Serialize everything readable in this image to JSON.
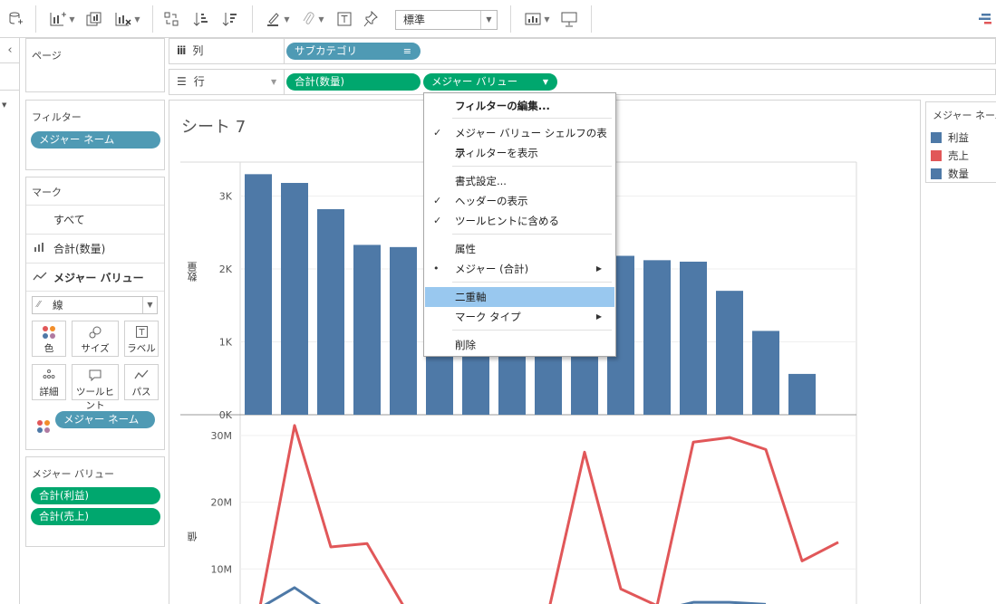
{
  "toolbar": {
    "style_select": "標準",
    "icons": [
      "new-datasource-icon",
      "new-sheet-icon",
      "duplicate-sheet-icon",
      "clear-sheet-icon",
      "swap-icon",
      "sort-asc-icon",
      "sort-desc-icon",
      "highlight-icon",
      "group-icon",
      "label-icon",
      "pin-icon",
      "show-me-icon",
      "presentation-icon"
    ]
  },
  "shelves": {
    "pages_label": "ページ",
    "columns_label": "列",
    "columns_pill": "サブカテゴリ",
    "rows_label": "行",
    "rows_pill1": "合計(数量)",
    "rows_pill2": "メジャー バリュー"
  },
  "filters": {
    "title": "フィルター",
    "pill": "メジャー ネーム"
  },
  "marks": {
    "title": "マーク",
    "all": "すべて",
    "row1": "合計(数量)",
    "row2": "メジャー バリュー",
    "mark_type": "線",
    "buttons": [
      "色",
      "サイズ",
      "ラベル",
      "詳細",
      "ツールヒント",
      "パス"
    ],
    "color_pill": "メジャー ネーム"
  },
  "measure_values": {
    "title": "メジャー バリュー",
    "items": [
      "合計(利益)",
      "合計(売上)"
    ]
  },
  "sheet_title": "シート 7",
  "legend": {
    "title": "メジャー ネーム",
    "items": [
      {
        "label": "利益",
        "color": "#4e79a7"
      },
      {
        "label": "売上",
        "color": "#e15759"
      },
      {
        "label": "数量",
        "color": "#4e79a7"
      }
    ]
  },
  "context_menu": {
    "items": [
      {
        "label": "フィルターの編集...",
        "bold": true
      },
      {
        "label": "メジャー バリュー シェルフの表示",
        "check": true
      },
      {
        "label": "フィルターを表示"
      },
      {
        "label": "書式設定..."
      },
      {
        "label": "ヘッダーの表示",
        "check": true
      },
      {
        "label": "ツールヒントに含める",
        "check": true
      },
      {
        "label": "属性"
      },
      {
        "label": "メジャー (合計)",
        "dot": true,
        "submenu": true
      },
      {
        "label": "二重軸",
        "highlighted": true
      },
      {
        "label": "マーク タイプ",
        "submenu": true
      },
      {
        "label": "削除"
      }
    ]
  },
  "chart_data": [
    {
      "type": "bar",
      "ylabel": "数量",
      "yticks": [
        "0K",
        "1K",
        "2K",
        "3K"
      ],
      "ylim": [
        0,
        3500
      ],
      "values": [
        3300,
        3180,
        2820,
        2330,
        2300,
        2200,
        2200,
        2200,
        2200,
        2200,
        2180,
        2120,
        2100,
        1700,
        1150,
        560
      ],
      "color": "#4e79a7"
    },
    {
      "type": "line",
      "ylabel": "値",
      "yticks": [
        "10M",
        "20M",
        "30M"
      ],
      "series": [
        {
          "name": "売上",
          "color": "#e15759",
          "values": [
            3000000,
            31500000,
            13300000,
            13800000,
            4500000,
            null,
            null,
            null,
            3500000,
            27500000,
            7000000,
            4500000,
            29000000,
            29700000,
            27900000,
            11200000,
            14000000
          ]
        },
        {
          "name": "利益",
          "color": "#4e79a7",
          "values": [
            4000000,
            7200000,
            3500000,
            null,
            null,
            null,
            null,
            null,
            null,
            null,
            null,
            3700000,
            5000000,
            5000000,
            4700000,
            null,
            null
          ]
        }
      ]
    }
  ]
}
